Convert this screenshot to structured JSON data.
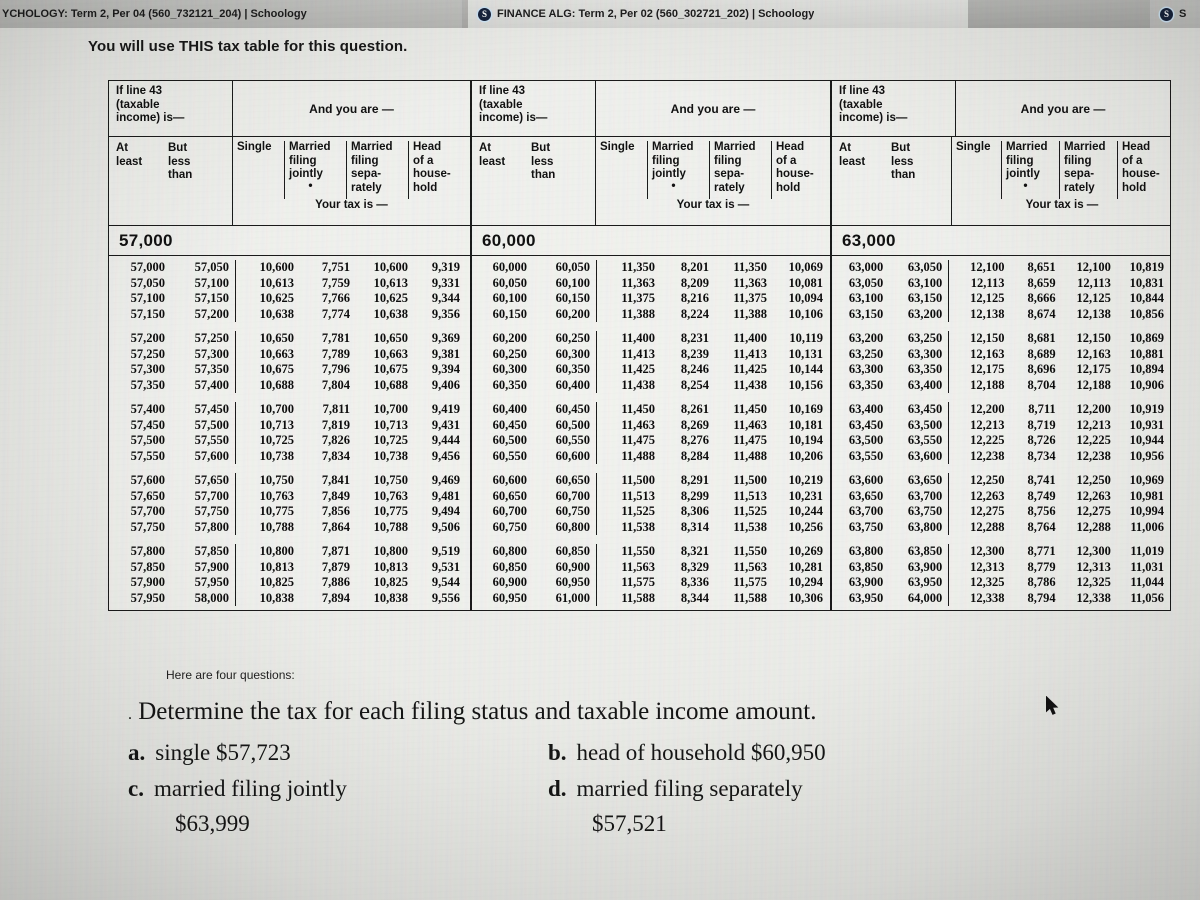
{
  "browser": {
    "tabs": [
      {
        "title": "YCHOLOGY: Term 2, Per 04 (560_732121_204) | Schoology",
        "favicon": "schoology-icon",
        "active": false
      },
      {
        "title": "FINANCE ALG: Term 2, Per 02 (560_302721_202) | Schoology",
        "favicon": "schoology-icon",
        "active": true
      },
      {
        "title": "S",
        "favicon": "schoology-icon",
        "active": false
      }
    ],
    "favicon_glyph": "S"
  },
  "lead_text": "You will use THIS tax table for this question.",
  "table_header": {
    "if_line": "If line 43\n(taxable\nincome) is—",
    "if_line_l1": "If line 43",
    "if_line_l2": "(taxable",
    "if_line_l3": "income) is—",
    "and_you_are": "And you are —",
    "at_least_l1": "At",
    "at_least_l2": "least",
    "but_less_l1": "But",
    "but_less_l2": "less",
    "but_less_l3": "than",
    "single": "Single",
    "mfj_l1": "Married",
    "mfj_l2": "filing",
    "mfj_l3": "jointly",
    "mfs_l1": "Married",
    "mfs_l2": "filing",
    "mfs_l3": "sepa-",
    "mfs_l4": "rately",
    "hoh_l1": "Head",
    "hoh_l2": "of a",
    "hoh_l3": "house-",
    "hoh_l4": "hold",
    "dot": "•",
    "your_tax_is": "Your tax is —"
  },
  "tables": [
    {
      "group": "57,000",
      "groups": [
        [
          [
            "57,000",
            "57,050",
            "10,600",
            "7,751",
            "10,600",
            "9,319"
          ],
          [
            "57,050",
            "57,100",
            "10,613",
            "7,759",
            "10,613",
            "9,331"
          ],
          [
            "57,100",
            "57,150",
            "10,625",
            "7,766",
            "10,625",
            "9,344"
          ],
          [
            "57,150",
            "57,200",
            "10,638",
            "7,774",
            "10,638",
            "9,356"
          ]
        ],
        [
          [
            "57,200",
            "57,250",
            "10,650",
            "7,781",
            "10,650",
            "9,369"
          ],
          [
            "57,250",
            "57,300",
            "10,663",
            "7,789",
            "10,663",
            "9,381"
          ],
          [
            "57,300",
            "57,350",
            "10,675",
            "7,796",
            "10,675",
            "9,394"
          ],
          [
            "57,350",
            "57,400",
            "10,688",
            "7,804",
            "10,688",
            "9,406"
          ]
        ],
        [
          [
            "57,400",
            "57,450",
            "10,700",
            "7,811",
            "10,700",
            "9,419"
          ],
          [
            "57,450",
            "57,500",
            "10,713",
            "7,819",
            "10,713",
            "9,431"
          ],
          [
            "57,500",
            "57,550",
            "10,725",
            "7,826",
            "10,725",
            "9,444"
          ],
          [
            "57,550",
            "57,600",
            "10,738",
            "7,834",
            "10,738",
            "9,456"
          ]
        ],
        [
          [
            "57,600",
            "57,650",
            "10,750",
            "7,841",
            "10,750",
            "9,469"
          ],
          [
            "57,650",
            "57,700",
            "10,763",
            "7,849",
            "10,763",
            "9,481"
          ],
          [
            "57,700",
            "57,750",
            "10,775",
            "7,856",
            "10,775",
            "9,494"
          ],
          [
            "57,750",
            "57,800",
            "10,788",
            "7,864",
            "10,788",
            "9,506"
          ]
        ],
        [
          [
            "57,800",
            "57,850",
            "10,800",
            "7,871",
            "10,800",
            "9,519"
          ],
          [
            "57,850",
            "57,900",
            "10,813",
            "7,879",
            "10,813",
            "9,531"
          ],
          [
            "57,900",
            "57,950",
            "10,825",
            "7,886",
            "10,825",
            "9,544"
          ],
          [
            "57,950",
            "58,000",
            "10,838",
            "7,894",
            "10,838",
            "9,556"
          ]
        ]
      ]
    },
    {
      "group": "60,000",
      "groups": [
        [
          [
            "60,000",
            "60,050",
            "11,350",
            "8,201",
            "11,350",
            "10,069"
          ],
          [
            "60,050",
            "60,100",
            "11,363",
            "8,209",
            "11,363",
            "10,081"
          ],
          [
            "60,100",
            "60,150",
            "11,375",
            "8,216",
            "11,375",
            "10,094"
          ],
          [
            "60,150",
            "60,200",
            "11,388",
            "8,224",
            "11,388",
            "10,106"
          ]
        ],
        [
          [
            "60,200",
            "60,250",
            "11,400",
            "8,231",
            "11,400",
            "10,119"
          ],
          [
            "60,250",
            "60,300",
            "11,413",
            "8,239",
            "11,413",
            "10,131"
          ],
          [
            "60,300",
            "60,350",
            "11,425",
            "8,246",
            "11,425",
            "10,144"
          ],
          [
            "60,350",
            "60,400",
            "11,438",
            "8,254",
            "11,438",
            "10,156"
          ]
        ],
        [
          [
            "60,400",
            "60,450",
            "11,450",
            "8,261",
            "11,450",
            "10,169"
          ],
          [
            "60,450",
            "60,500",
            "11,463",
            "8,269",
            "11,463",
            "10,181"
          ],
          [
            "60,500",
            "60,550",
            "11,475",
            "8,276",
            "11,475",
            "10,194"
          ],
          [
            "60,550",
            "60,600",
            "11,488",
            "8,284",
            "11,488",
            "10,206"
          ]
        ],
        [
          [
            "60,600",
            "60,650",
            "11,500",
            "8,291",
            "11,500",
            "10,219"
          ],
          [
            "60,650",
            "60,700",
            "11,513",
            "8,299",
            "11,513",
            "10,231"
          ],
          [
            "60,700",
            "60,750",
            "11,525",
            "8,306",
            "11,525",
            "10,244"
          ],
          [
            "60,750",
            "60,800",
            "11,538",
            "8,314",
            "11,538",
            "10,256"
          ]
        ],
        [
          [
            "60,800",
            "60,850",
            "11,550",
            "8,321",
            "11,550",
            "10,269"
          ],
          [
            "60,850",
            "60,900",
            "11,563",
            "8,329",
            "11,563",
            "10,281"
          ],
          [
            "60,900",
            "60,950",
            "11,575",
            "8,336",
            "11,575",
            "10,294"
          ],
          [
            "60,950",
            "61,000",
            "11,588",
            "8,344",
            "11,588",
            "10,306"
          ]
        ]
      ]
    },
    {
      "group": "63,000",
      "groups": [
        [
          [
            "63,000",
            "63,050",
            "12,100",
            "8,651",
            "12,100",
            "10,819"
          ],
          [
            "63,050",
            "63,100",
            "12,113",
            "8,659",
            "12,113",
            "10,831"
          ],
          [
            "63,100",
            "63,150",
            "12,125",
            "8,666",
            "12,125",
            "10,844"
          ],
          [
            "63,150",
            "63,200",
            "12,138",
            "8,674",
            "12,138",
            "10,856"
          ]
        ],
        [
          [
            "63,200",
            "63,250",
            "12,150",
            "8,681",
            "12,150",
            "10,869"
          ],
          [
            "63,250",
            "63,300",
            "12,163",
            "8,689",
            "12,163",
            "10,881"
          ],
          [
            "63,300",
            "63,350",
            "12,175",
            "8,696",
            "12,175",
            "10,894"
          ],
          [
            "63,350",
            "63,400",
            "12,188",
            "8,704",
            "12,188",
            "10,906"
          ]
        ],
        [
          [
            "63,400",
            "63,450",
            "12,200",
            "8,711",
            "12,200",
            "10,919"
          ],
          [
            "63,450",
            "63,500",
            "12,213",
            "8,719",
            "12,213",
            "10,931"
          ],
          [
            "63,500",
            "63,550",
            "12,225",
            "8,726",
            "12,225",
            "10,944"
          ],
          [
            "63,550",
            "63,600",
            "12,238",
            "8,734",
            "12,238",
            "10,956"
          ]
        ],
        [
          [
            "63,600",
            "63,650",
            "12,250",
            "8,741",
            "12,250",
            "10,969"
          ],
          [
            "63,650",
            "63,700",
            "12,263",
            "8,749",
            "12,263",
            "10,981"
          ],
          [
            "63,700",
            "63,750",
            "12,275",
            "8,756",
            "12,275",
            "10,994"
          ],
          [
            "63,750",
            "63,800",
            "12,288",
            "8,764",
            "12,288",
            "11,006"
          ]
        ],
        [
          [
            "63,800",
            "63,850",
            "12,300",
            "8,771",
            "12,300",
            "11,019"
          ],
          [
            "63,850",
            "63,900",
            "12,313",
            "8,779",
            "12,313",
            "11,031"
          ],
          [
            "63,900",
            "63,950",
            "12,325",
            "8,786",
            "12,325",
            "11,044"
          ],
          [
            "63,950",
            "64,000",
            "12,338",
            "8,794",
            "12,338",
            "11,056"
          ]
        ]
      ]
    }
  ],
  "questions": {
    "intro": "Here are four questions:",
    "bullet": ".",
    "main": "Determine the tax for each filing status and taxable income amount.",
    "items": [
      {
        "label": "a.",
        "text": "single $57,723",
        "amount": ""
      },
      {
        "label": "b.",
        "text": "head of household $60,950",
        "amount": ""
      },
      {
        "label": "c.",
        "text": "married filing jointly",
        "amount": "$63,999"
      },
      {
        "label": "d.",
        "text": "married filing separately",
        "amount": "$57,521"
      }
    ]
  },
  "colors": {
    "page_bg": "#e9e9e5",
    "tabstrip": "#aeaeab",
    "table_border": "#1a1a1a",
    "text": "#101010"
  }
}
